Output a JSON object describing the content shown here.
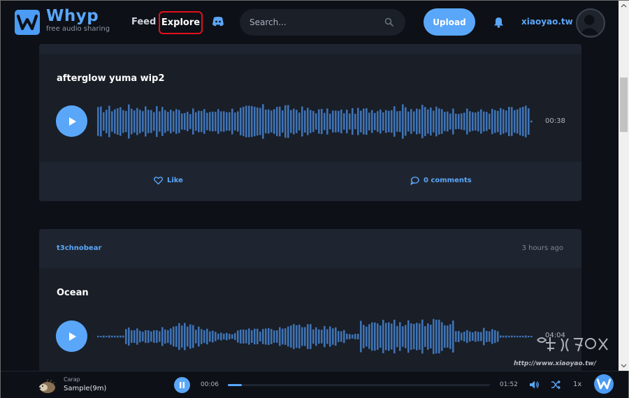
{
  "app": {
    "brand_name": "Whyp",
    "tagline": "free audio sharing",
    "accent": "#5aa7fa",
    "highlight_color": "#e3101c"
  },
  "nav": {
    "feed_label": "Feed",
    "explore_label": "Explore",
    "discord_icon": "discord-icon"
  },
  "search": {
    "placeholder": "Search...",
    "value": ""
  },
  "actions": {
    "upload_label": "Upload",
    "notifications_icon": "bell-icon"
  },
  "user": {
    "username": "xiaoyao.tw"
  },
  "tracks": [
    {
      "title": "afterglow yuma wip2",
      "duration": "00:38",
      "like_label": "Like",
      "comments_label": "0 comments"
    },
    {
      "author": "t3chnobear",
      "time_ago": "3 hours ago",
      "title": "Ocean",
      "duration": "04:04"
    }
  ],
  "player": {
    "artist": "Carap",
    "title": "Sample(9m)",
    "current_time": "00:06",
    "total_time": "01:52",
    "progress_fraction": 0.053,
    "speed_label": "1x"
  },
  "watermark": {
    "text": "http://www.xiaoyao.tw/"
  }
}
